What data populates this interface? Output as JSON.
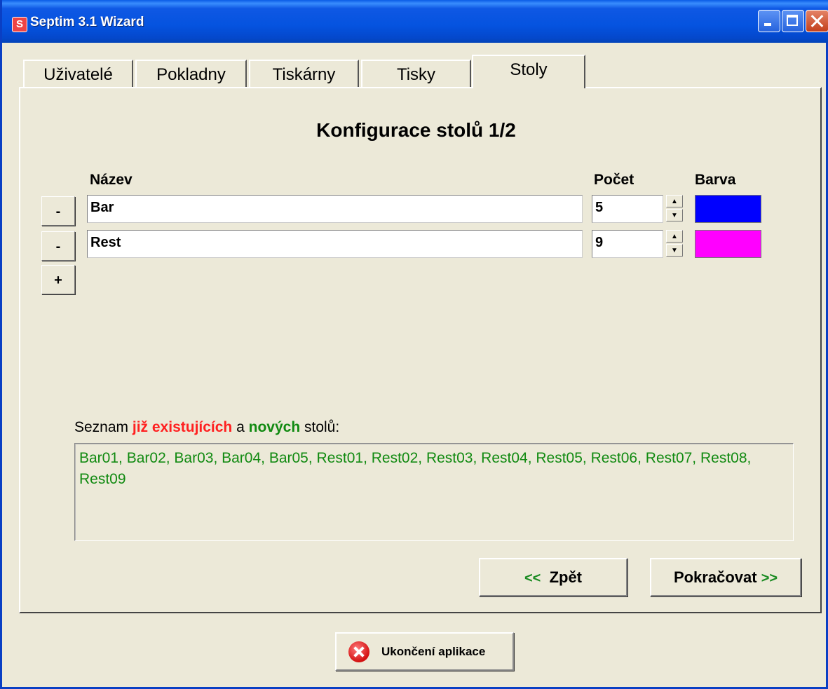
{
  "window": {
    "title": "Septim 3.1 Wizard",
    "app_icon_letter": "S"
  },
  "tabs": [
    {
      "label": "Uživatelé"
    },
    {
      "label": "Pokladny"
    },
    {
      "label": "Tiskárny"
    },
    {
      "label": "Tisky"
    },
    {
      "label": "Stoly",
      "active": true
    }
  ],
  "page": {
    "heading": "Konfigurace stolů 1/2",
    "columns": {
      "name": "Název",
      "count": "Počet",
      "color": "Barva"
    },
    "rows": [
      {
        "remove_label": "-",
        "name": "Bar",
        "count": "5",
        "color": "#0000FF"
      },
      {
        "remove_label": "-",
        "name": "Rest",
        "count": "9",
        "color": "#FF00FF"
      }
    ],
    "add_label": "+",
    "list": {
      "label_part1": "Seznam ",
      "label_existing": "již existujících",
      "label_part2": " a ",
      "label_new": "nových",
      "label_part3": " stolů:",
      "content": "Bar01, Bar02, Bar03, Bar04, Bar05, Rest01, Rest02, Rest03, Rest04, Rest05, Rest06, Rest07, Rest08, Rest09"
    },
    "buttons": {
      "back": "Zpět",
      "back_arrow": "<<",
      "next": "Pokračovat",
      "next_arrow": ">>"
    }
  },
  "footer": {
    "exit_label": "Ukončení aplikace"
  },
  "colors": {
    "existing": "#FF2020",
    "new": "#118A11"
  }
}
